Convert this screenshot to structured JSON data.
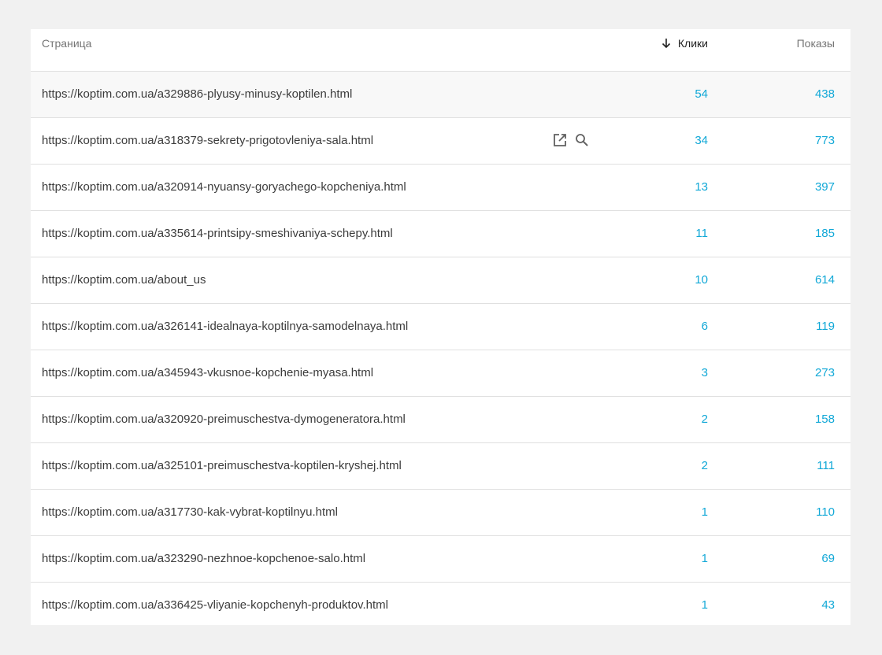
{
  "table": {
    "headers": {
      "page": "Страница",
      "clicks": "Клики",
      "impressions": "Показы"
    },
    "sort_icon": "arrow-down-icon",
    "row_action_icons": [
      "open-in-new-icon",
      "search-icon"
    ],
    "rows": [
      {
        "url": "https://koptim.com.ua/a329886-plyusy-minusy-koptilen.html",
        "clicks": "54",
        "impressions": "438"
      },
      {
        "url": "https://koptim.com.ua/a318379-sekrety-prigotovleniya-sala.html",
        "clicks": "34",
        "impressions": "773"
      },
      {
        "url": "https://koptim.com.ua/a320914-nyuansy-goryachego-kopcheniya.html",
        "clicks": "13",
        "impressions": "397"
      },
      {
        "url": "https://koptim.com.ua/a335614-printsipy-smeshivaniya-schepy.html",
        "clicks": "11",
        "impressions": "185"
      },
      {
        "url": "https://koptim.com.ua/about_us",
        "clicks": "10",
        "impressions": "614"
      },
      {
        "url": "https://koptim.com.ua/a326141-idealnaya-koptilnya-samodelnaya.html",
        "clicks": "6",
        "impressions": "119"
      },
      {
        "url": "https://koptim.com.ua/a345943-vkusnoe-kopchenie-myasa.html",
        "clicks": "3",
        "impressions": "273"
      },
      {
        "url": "https://koptim.com.ua/a320920-preimuschestva-dymogeneratora.html",
        "clicks": "2",
        "impressions": "158"
      },
      {
        "url": "https://koptim.com.ua/a325101-preimuschestva-koptilen-kryshej.html",
        "clicks": "2",
        "impressions": "111"
      },
      {
        "url": "https://koptim.com.ua/a317730-kak-vybrat-koptilnyu.html",
        "clicks": "1",
        "impressions": "110"
      },
      {
        "url": "https://koptim.com.ua/a323290-nezhnoe-kopchenoe-salo.html",
        "clicks": "1",
        "impressions": "69"
      },
      {
        "url": "https://koptim.com.ua/a336425-vliyanie-kopchenyh-produktov.html",
        "clicks": "1",
        "impressions": "43"
      }
    ]
  },
  "colors": {
    "link_number": "#11a8d7",
    "background": "#f1f1f1"
  }
}
